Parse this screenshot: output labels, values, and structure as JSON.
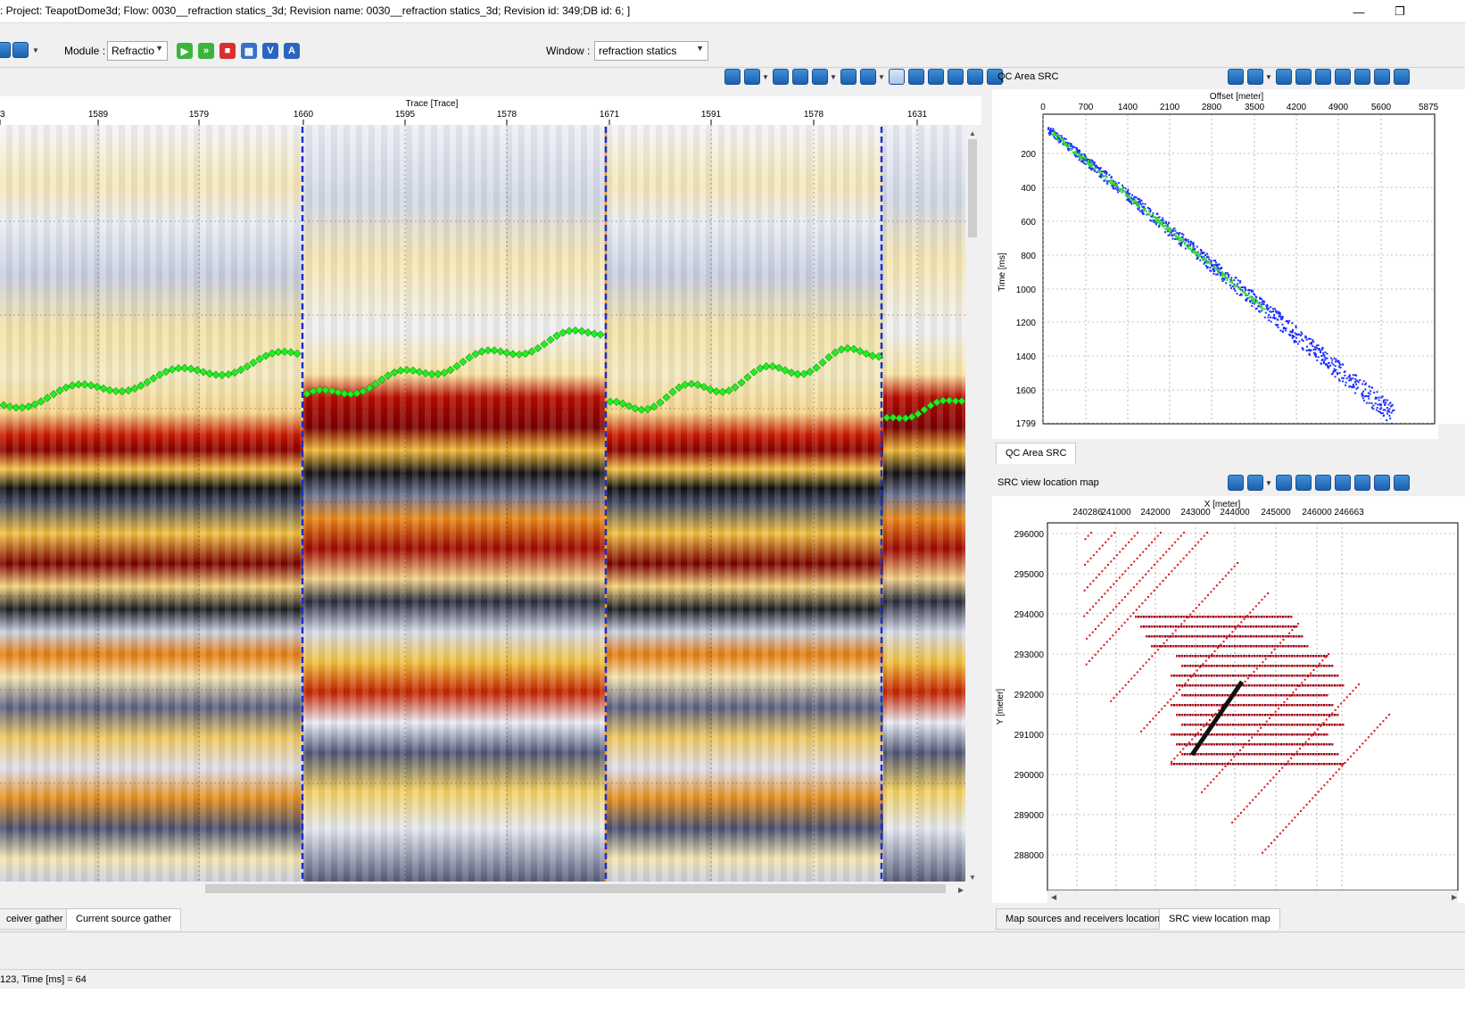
{
  "window": {
    "title": ": Project: TeapotDome3d; Flow: 0030__refraction statics_3d; Revision name: 0030__refraction statics_3d; Revision id: 349;DB id: 6; ]",
    "minimize_glyph": "—",
    "restore_glyph": "❐"
  },
  "toolbar": {
    "module_label": "Module :",
    "module_value": "Refractio",
    "window_label": "Window :",
    "window_value": "refraction statics",
    "run_buttons": [
      "play-icon",
      "run-all-icon",
      "stop-icon",
      "batch-icon",
      "view-icon",
      "text-icon"
    ],
    "v_glyph": "V",
    "a_glyph": "A"
  },
  "main_plot": {
    "x_title": "Trace [Trace]",
    "x_ticks": [
      "3",
      "1589",
      "1579",
      "1660",
      "1595",
      "1578",
      "1671",
      "1591",
      "1578",
      "1631"
    ]
  },
  "qc_plot": {
    "panel_title": "QC Area SRC",
    "x_title": "Offset [meter]",
    "y_title": "Time [ms]",
    "x_ticks": [
      "0",
      "700",
      "1400",
      "2100",
      "2800",
      "3500",
      "4200",
      "4900",
      "5600"
    ],
    "x_max_label": "5875",
    "y_ticks": [
      "200",
      "400",
      "600",
      "800",
      "1000",
      "1200",
      "1400",
      "1600",
      "1799"
    ]
  },
  "qc_tabs": [
    "QC Area SRC"
  ],
  "map_plot": {
    "panel_title": "SRC view location map",
    "x_title": "X [meter]",
    "y_title": "Y [meter]",
    "x_ticks": [
      "240286",
      "241000",
      "242000",
      "243000",
      "244000",
      "245000",
      "246000",
      "246663"
    ],
    "y_ticks": [
      "296000",
      "295000",
      "294000",
      "293000",
      "292000",
      "291000",
      "290000",
      "289000",
      "288000"
    ]
  },
  "bottom_tabs_left": [
    "ceiver gather",
    "Current source gather"
  ],
  "bottom_tabs_right": [
    "Map sources and receivers location",
    "SRC view location map"
  ],
  "status": {
    "text": "123, Time [ms] = 64"
  },
  "colors": {
    "first_break": "#22ee22",
    "divider": "#1a2fd0",
    "divider_alt": "#f0a020",
    "qc_blue": "#1a2cff",
    "qc_green": "#33dd33",
    "map_red": "#dd1111",
    "map_line": "#111111"
  }
}
